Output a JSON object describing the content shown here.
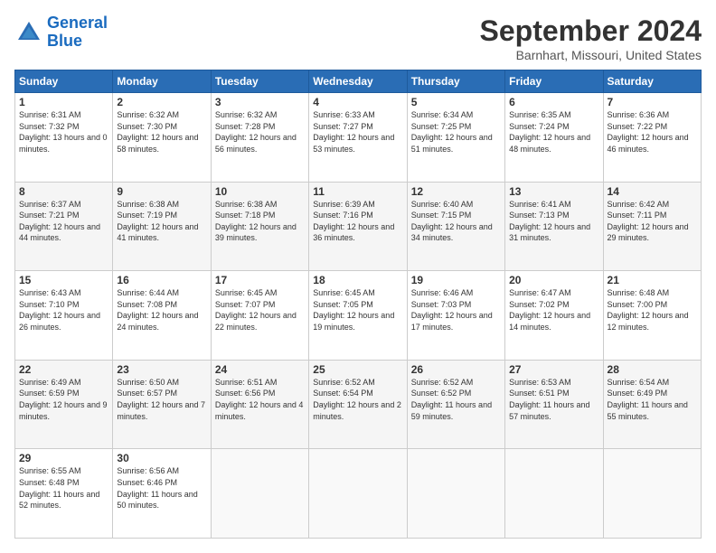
{
  "header": {
    "logo_line1": "General",
    "logo_line2": "Blue",
    "month": "September 2024",
    "location": "Barnhart, Missouri, United States"
  },
  "weekdays": [
    "Sunday",
    "Monday",
    "Tuesday",
    "Wednesday",
    "Thursday",
    "Friday",
    "Saturday"
  ],
  "weeks": [
    [
      {
        "day": 1,
        "sunrise": "6:31 AM",
        "sunset": "7:32 PM",
        "daylight": "13 hours and 0 minutes."
      },
      {
        "day": 2,
        "sunrise": "6:32 AM",
        "sunset": "7:30 PM",
        "daylight": "12 hours and 58 minutes."
      },
      {
        "day": 3,
        "sunrise": "6:32 AM",
        "sunset": "7:28 PM",
        "daylight": "12 hours and 56 minutes."
      },
      {
        "day": 4,
        "sunrise": "6:33 AM",
        "sunset": "7:27 PM",
        "daylight": "12 hours and 53 minutes."
      },
      {
        "day": 5,
        "sunrise": "6:34 AM",
        "sunset": "7:25 PM",
        "daylight": "12 hours and 51 minutes."
      },
      {
        "day": 6,
        "sunrise": "6:35 AM",
        "sunset": "7:24 PM",
        "daylight": "12 hours and 48 minutes."
      },
      {
        "day": 7,
        "sunrise": "6:36 AM",
        "sunset": "7:22 PM",
        "daylight": "12 hours and 46 minutes."
      }
    ],
    [
      {
        "day": 8,
        "sunrise": "6:37 AM",
        "sunset": "7:21 PM",
        "daylight": "12 hours and 44 minutes."
      },
      {
        "day": 9,
        "sunrise": "6:38 AM",
        "sunset": "7:19 PM",
        "daylight": "12 hours and 41 minutes."
      },
      {
        "day": 10,
        "sunrise": "6:38 AM",
        "sunset": "7:18 PM",
        "daylight": "12 hours and 39 minutes."
      },
      {
        "day": 11,
        "sunrise": "6:39 AM",
        "sunset": "7:16 PM",
        "daylight": "12 hours and 36 minutes."
      },
      {
        "day": 12,
        "sunrise": "6:40 AM",
        "sunset": "7:15 PM",
        "daylight": "12 hours and 34 minutes."
      },
      {
        "day": 13,
        "sunrise": "6:41 AM",
        "sunset": "7:13 PM",
        "daylight": "12 hours and 31 minutes."
      },
      {
        "day": 14,
        "sunrise": "6:42 AM",
        "sunset": "7:11 PM",
        "daylight": "12 hours and 29 minutes."
      }
    ],
    [
      {
        "day": 15,
        "sunrise": "6:43 AM",
        "sunset": "7:10 PM",
        "daylight": "12 hours and 26 minutes."
      },
      {
        "day": 16,
        "sunrise": "6:44 AM",
        "sunset": "7:08 PM",
        "daylight": "12 hours and 24 minutes."
      },
      {
        "day": 17,
        "sunrise": "6:45 AM",
        "sunset": "7:07 PM",
        "daylight": "12 hours and 22 minutes."
      },
      {
        "day": 18,
        "sunrise": "6:45 AM",
        "sunset": "7:05 PM",
        "daylight": "12 hours and 19 minutes."
      },
      {
        "day": 19,
        "sunrise": "6:46 AM",
        "sunset": "7:03 PM",
        "daylight": "12 hours and 17 minutes."
      },
      {
        "day": 20,
        "sunrise": "6:47 AM",
        "sunset": "7:02 PM",
        "daylight": "12 hours and 14 minutes."
      },
      {
        "day": 21,
        "sunrise": "6:48 AM",
        "sunset": "7:00 PM",
        "daylight": "12 hours and 12 minutes."
      }
    ],
    [
      {
        "day": 22,
        "sunrise": "6:49 AM",
        "sunset": "6:59 PM",
        "daylight": "12 hours and 9 minutes."
      },
      {
        "day": 23,
        "sunrise": "6:50 AM",
        "sunset": "6:57 PM",
        "daylight": "12 hours and 7 minutes."
      },
      {
        "day": 24,
        "sunrise": "6:51 AM",
        "sunset": "6:56 PM",
        "daylight": "12 hours and 4 minutes."
      },
      {
        "day": 25,
        "sunrise": "6:52 AM",
        "sunset": "6:54 PM",
        "daylight": "12 hours and 2 minutes."
      },
      {
        "day": 26,
        "sunrise": "6:52 AM",
        "sunset": "6:52 PM",
        "daylight": "11 hours and 59 minutes."
      },
      {
        "day": 27,
        "sunrise": "6:53 AM",
        "sunset": "6:51 PM",
        "daylight": "11 hours and 57 minutes."
      },
      {
        "day": 28,
        "sunrise": "6:54 AM",
        "sunset": "6:49 PM",
        "daylight": "11 hours and 55 minutes."
      }
    ],
    [
      {
        "day": 29,
        "sunrise": "6:55 AM",
        "sunset": "6:48 PM",
        "daylight": "11 hours and 52 minutes."
      },
      {
        "day": 30,
        "sunrise": "6:56 AM",
        "sunset": "6:46 PM",
        "daylight": "11 hours and 50 minutes."
      },
      null,
      null,
      null,
      null,
      null
    ]
  ]
}
